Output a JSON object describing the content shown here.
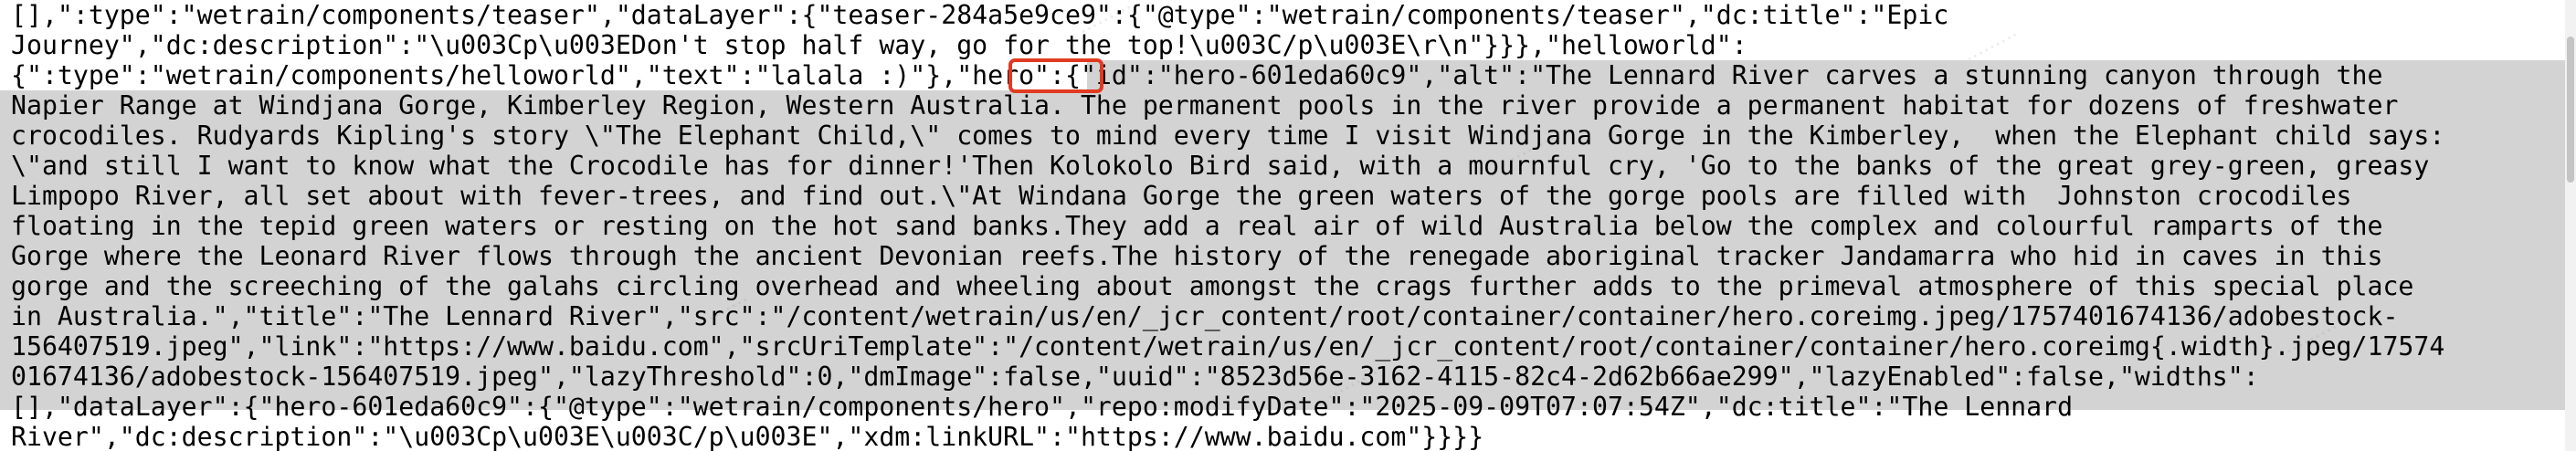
{
  "lines": [
    "[],\":type\":\"wetrain/components/teaser\",\"dataLayer\":{\"teaser-284a5e9ce9\":{\"@type\":\"wetrain/components/teaser\",\"dc:title\":\"Epic",
    "Journey\",\"dc:description\":\"\\u003Cp\\u003EDon't stop half way, go for the top!\\u003C/p\\u003E\\r\\n\"}}},\"helloworld\":",
    "{\":type\":\"wetrain/components/helloworld\",\"text\":\"lalala :)\"},\"hero\":{\"id\":\"hero-601eda60c9\",\"alt\":\"The Lennard River carves a stunning canyon through the",
    "Napier Range at Windjana Gorge, Kimberley Region, Western Australia. The permanent pools in the river provide a permanent habitat for dozens of freshwater",
    "crocodiles. Rudyards Kipling's story \\\"The Elephant Child,\\\" comes to mind every time I visit Windjana Gorge in the Kimberley,  when the Elephant child says:",
    "\\\"and still I want to know what the Crocodile has for dinner!'Then Kolokolo Bird said, with a mournful cry, 'Go to the banks of the great grey-green, greasy",
    "Limpopo River, all set about with fever-trees, and find out.\\\"At Windana Gorge the green waters of the gorge pools are filled with  Johnston crocodiles",
    "floating in the tepid green waters or resting on the hot sand banks.They add a real air of wild Australia below the complex and colourful ramparts of the",
    "Gorge where the Leonard River flows through the ancient Devonian reefs.The history of the renegade aboriginal tracker Jandamarra who hid in caves in this",
    "gorge and the screeching of the galahs circling overhead and wheeling about amongst the crags further adds to the primeval atmosphere of this special place",
    "in Australia.\",\"title\":\"The Lennard River\",\"src\":\"/content/wetrain/us/en/_jcr_content/root/container/container/hero.coreimg.jpeg/1757401674136/adobestock-",
    "156407519.jpeg\",\"link\":\"https://www.baidu.com\",\"srcUriTemplate\":\"/content/wetrain/us/en/_jcr_content/root/container/container/hero.coreimg{.width}.jpeg/17574",
    "01674136/adobestock-156407519.jpeg\",\"lazyThreshold\":0,\"dmImage\":false,\"uuid\":\"8523d56e-3162-4115-82c4-2d62b66ae299\",\"lazyEnabled\":false,\"widths\":",
    "[],\"dataLayer\":{\"hero-601eda60c9\":{\"@type\":\"wetrain/components/hero\",\"repo:modifyDate\":\"2025-09-09T07:07:54Z\",\"dc:title\":\"The Lennard",
    "River\",\"dc:description\":\"\\u003Cp\\u003E\\u003C/p\\u003E\",\"xdm:linkURL\":\"https://www.baidu.com\"}}}}"
  ]
}
